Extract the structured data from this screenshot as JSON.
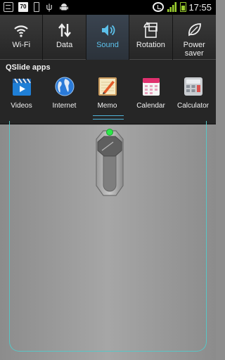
{
  "status_bar": {
    "battery_level_badge": "70",
    "time": "17:55",
    "icons": [
      "notification-icon",
      "battery-level-badge",
      "storage-icon",
      "usb-icon",
      "android-icon",
      "alarm-icon",
      "signal-icon",
      "battery-icon"
    ],
    "battery_color": "#9ccf2f"
  },
  "quick_settings": {
    "tiles": [
      {
        "label": "Wi-Fi",
        "icon": "wifi-icon",
        "active": false
      },
      {
        "label": "Data",
        "icon": "data-arrows-icon",
        "active": false
      },
      {
        "label": "Sound",
        "icon": "speaker-icon",
        "active": true
      },
      {
        "label": "Rotation",
        "icon": "rotation-icon",
        "active": false
      },
      {
        "label": "Power\nsaver",
        "icon": "leaf-icon",
        "active": false
      }
    ],
    "active_color": "#5cc0ea"
  },
  "qslide": {
    "title": "QSlide apps",
    "apps": [
      {
        "label": "Videos",
        "icon": "clapperboard-icon"
      },
      {
        "label": "Internet",
        "icon": "globe-icon"
      },
      {
        "label": "Memo",
        "icon": "memo-icon"
      },
      {
        "label": "Calendar",
        "icon": "calendar-icon"
      },
      {
        "label": "Calculator",
        "icon": "calculator-icon"
      }
    ]
  },
  "main": {
    "switch_indicator_color": "#2ee84a",
    "frame_color": "#58c6c6"
  }
}
